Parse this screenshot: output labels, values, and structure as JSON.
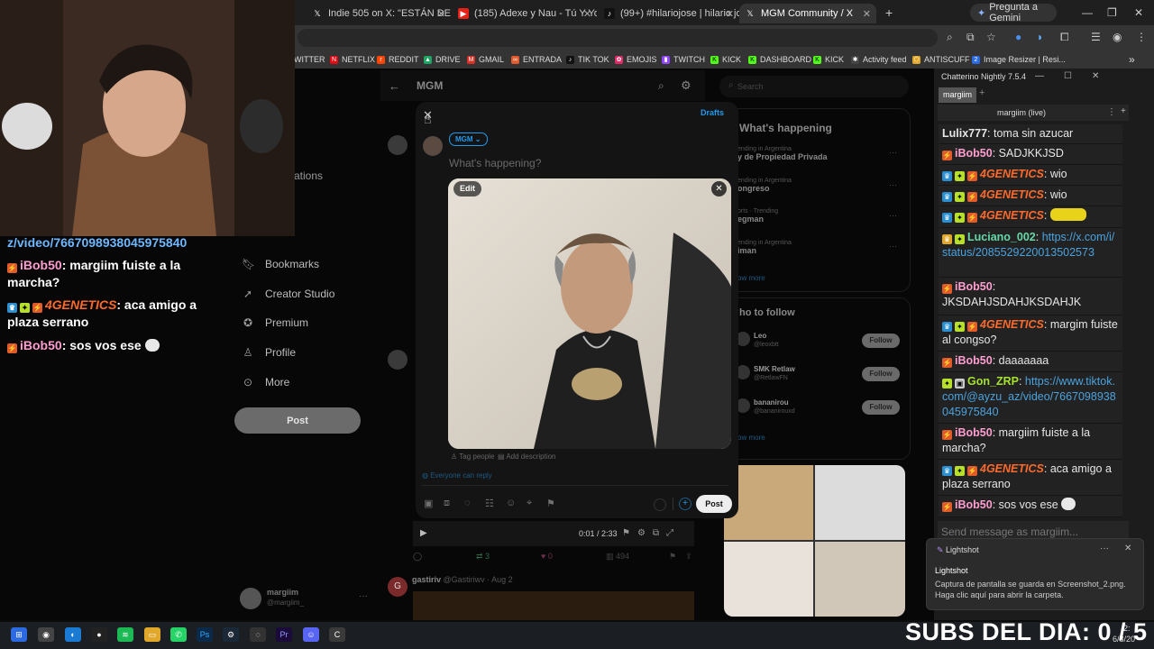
{
  "browser": {
    "tabs": [
      {
        "label": "Indie 505 on X: \"ESTÁN DE REG",
        "icon": "x-logo"
      },
      {
        "label": "(185) Adexe y Nau - Tú Y Yo (Vi",
        "icon": "youtube-icon"
      },
      {
        "label": "(99+) #hilariojose | hilario jose |",
        "icon": "tiktok-icon"
      },
      {
        "label": "MGM Community / X",
        "icon": "x-logo"
      }
    ],
    "new_tab": "+",
    "gemini_label": "Pregunta a Gemini",
    "bookmarks": [
      "WITTER",
      "NETFLIX",
      "REDDIT",
      "DRIVE",
      "GMAIL",
      "ENTRADA",
      "TIK TOK",
      "EMOJIS",
      "TWITCH",
      "KICK",
      "DASHBOARD",
      "KICK",
      "Activity feed",
      "ANTISCUFF",
      "Image Resizer | Resi..."
    ]
  },
  "x": {
    "header_title": "MGM",
    "search_placeholder": "Search",
    "nav": [
      {
        "label": "Bookmarks",
        "icon": "bookmark-icon"
      },
      {
        "label": "Creator Studio",
        "icon": "rocket-icon"
      },
      {
        "label": "Premium",
        "icon": "verified-icon"
      },
      {
        "label": "Profile",
        "icon": "person-icon"
      },
      {
        "label": "More",
        "icon": "more-circle-icon"
      }
    ],
    "nav_partial": [
      "e",
      "ations"
    ],
    "post_button": "Post",
    "account_name": "margiim",
    "account_handle": "@margiim_",
    "happening_title": "What's happening",
    "trends": [
      {
        "meta": "ending in Argentina",
        "name": "y de Propiedad Privada"
      },
      {
        "meta": "ending in Argentina",
        "name": "ongreso"
      },
      {
        "meta": "orts · Trending",
        "name": "egman"
      },
      {
        "meta": "ending in Argentina",
        "name": "iman"
      }
    ],
    "show_more": "ow more",
    "who_to_follow_title": "ho to follow",
    "follow_suggestions": [
      {
        "name": "Leo",
        "handle": "@leoxbtt",
        "button": "Follow"
      },
      {
        "name": "SMK Retlaw",
        "handle": "@RetlawFN",
        "button": "Follow"
      },
      {
        "name": "bananirou",
        "handle": "@bananirouxd",
        "button": "Follow"
      }
    ],
    "video_time": "0:01 / 2:33",
    "feed_post_author": "gastiriv",
    "feed_post_meta": "@Gastiriwv · Aug 2",
    "feed_stats": [
      "3",
      "0",
      "494"
    ]
  },
  "composer": {
    "drafts": "Drafts",
    "audience": "MGM",
    "placeholder": "What's happening?",
    "edit_label": "Edit",
    "tag_people": "Tag people",
    "add_description": "Add description",
    "reply_setting": "Everyone can reply",
    "post_button": "Post"
  },
  "chatterino": {
    "title": "Chatterino Nightly 7.5.4",
    "tab": "margiim",
    "channel": "margiim (live)",
    "input_placeholder": "Send message as margiim...",
    "messages": [
      {
        "user": "Lulix777",
        "color": "#e6e6e6",
        "text": "toma sin azucar",
        "badges": []
      },
      {
        "user": "iBob50",
        "color": "#ff9ecf",
        "text": "SADJKKJSD",
        "badges": [
          "#e05a2b"
        ]
      },
      {
        "user": "4GENETICS",
        "color": "#ff6a2b",
        "text": "wio",
        "badges": [
          "#2a8fd0",
          "#b7e02b",
          "#e05a2b"
        ]
      },
      {
        "user": "4GENETICS",
        "color": "#ff6a2b",
        "text": "wio",
        "badges": [
          "#2a8fd0",
          "#b7e02b",
          "#e05a2b"
        ]
      },
      {
        "user": "4GENETICS",
        "color": "#ff6a2b",
        "text": "",
        "badges": [
          "#2a8fd0",
          "#b7e02b",
          "#e05a2b"
        ],
        "emote": true
      },
      {
        "user": "Luciano_002",
        "color": "#66d9a8",
        "text": "https://x.com/i/status/2085529220013502573",
        "badges": [
          "#e0a72b",
          "#b7e02b"
        ],
        "link": true
      },
      {
        "user": "iBob50",
        "color": "#ff9ecf",
        "text": "JKSDAHJSDAHJKSDAHJK",
        "badges": [
          "#e05a2b"
        ]
      },
      {
        "user": "4GENETICS",
        "color": "#ff6a2b",
        "text": "margim fuiste al congso?",
        "badges": [
          "#2a8fd0",
          "#b7e02b",
          "#e05a2b"
        ]
      },
      {
        "user": "iBob50",
        "color": "#ff9ecf",
        "text": "daaaaaaa",
        "badges": [
          "#e05a2b"
        ]
      },
      {
        "user": "Gon_ZRP",
        "color": "#a6e22e",
        "text": "https://www.tiktok.com/@ayzu_az/video/7667098938045975840",
        "badges": [
          "#b7e02b",
          "#cccccc"
        ],
        "link": true
      },
      {
        "user": "iBob50",
        "color": "#ff9ecf",
        "text": "margiim fuiste a la marcha?",
        "badges": [
          "#e05a2b"
        ]
      },
      {
        "user": "4GENETICS",
        "color": "#ff6a2b",
        "text": "aca amigo a plaza serrano",
        "badges": [
          "#2a8fd0",
          "#b7e02b",
          "#e05a2b"
        ]
      },
      {
        "user": "iBob50",
        "color": "#ff9ecf",
        "text": "sos vos ese",
        "badges": [
          "#e05a2b"
        ],
        "emote_after": true
      }
    ]
  },
  "overlay": {
    "link": "z/video/7667098938045975840",
    "messages": [
      {
        "user": "iBob50",
        "color": "#ff9ecf",
        "text": "margiim fuiste a la marcha?"
      },
      {
        "user": "4GENETICS",
        "color": "#ff6a2b",
        "text": "aca amigo a plaza serrano"
      },
      {
        "user": "iBob50",
        "color": "#ff9ecf",
        "text": "sos vos ese"
      }
    ]
  },
  "toast": {
    "app": "Lightshot",
    "title": "Lightshot",
    "body": "Captura de pantalla se guarda en Screenshot_2.png. Haga clic aquí para abrir la carpeta."
  },
  "taskbar": {
    "time": "2:",
    "date": "6/8/20",
    "subs": "SUBS DEL DIA: 0 / 5"
  }
}
